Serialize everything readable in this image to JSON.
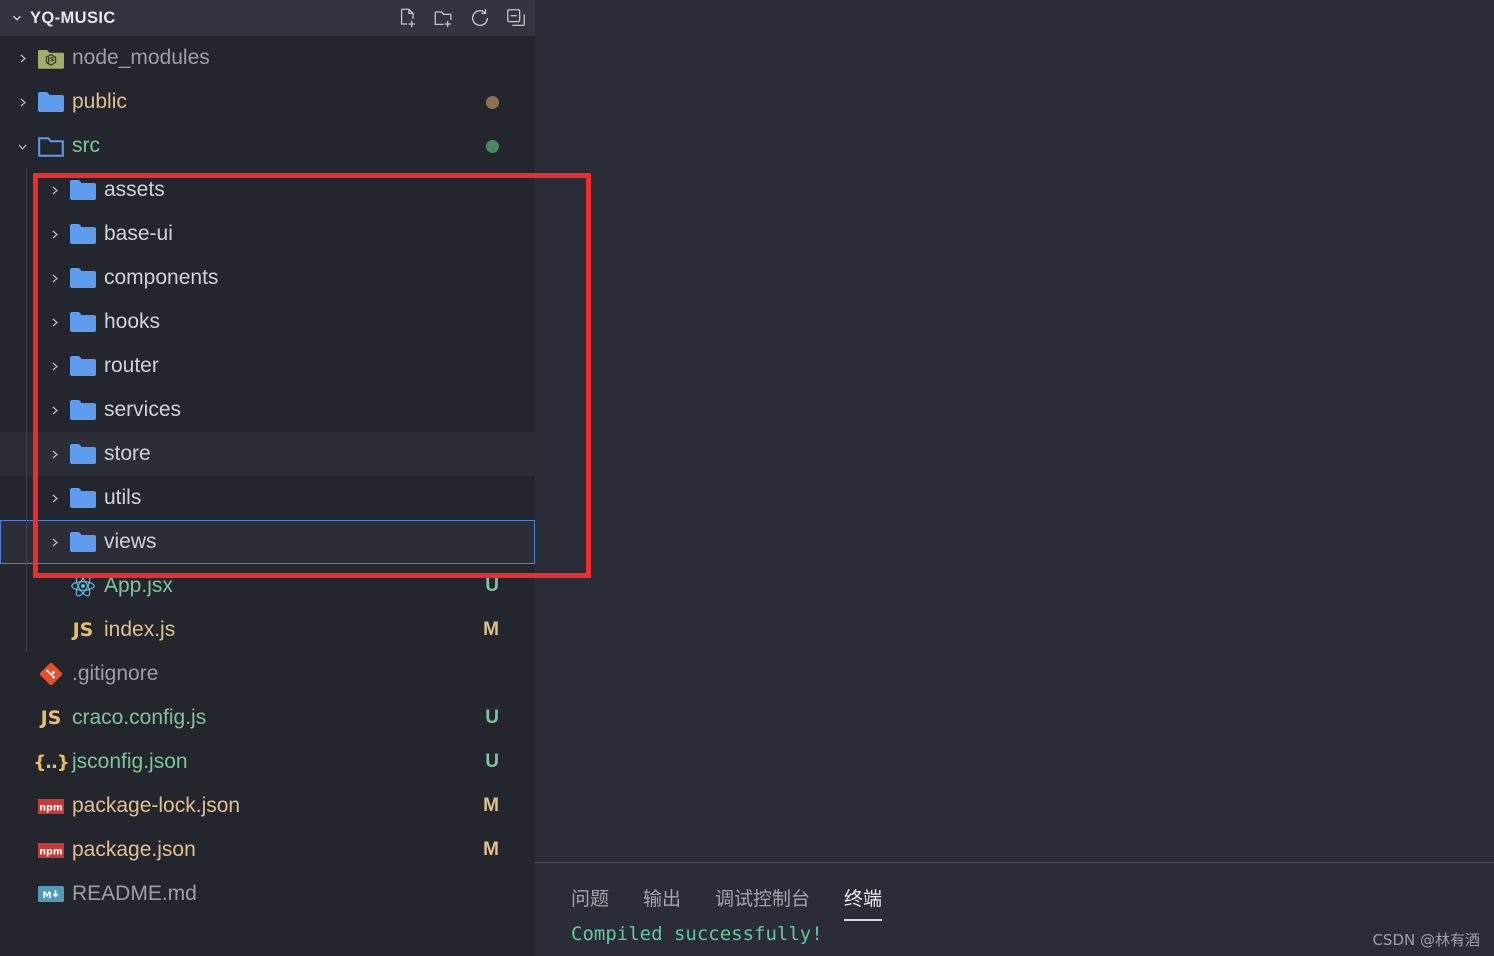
{
  "sidebar": {
    "title": "YQ-MUSIC",
    "twisty_icon": "chevron-down-icon",
    "actions": [
      {
        "name": "new-file-icon",
        "label": "New File"
      },
      {
        "name": "new-folder-icon",
        "label": "New Folder"
      },
      {
        "name": "refresh-icon",
        "label": "Refresh Explorer"
      },
      {
        "name": "collapse-all-icon",
        "label": "Collapse Folders in Explorer"
      }
    ],
    "tree": [
      {
        "label": "node_modules",
        "icon": "node-folder-icon",
        "chevron": "chevron-right-icon",
        "indent": 0,
        "color": "c-dim",
        "badge": "",
        "dot": ""
      },
      {
        "label": "public",
        "icon": "folder-icon",
        "chevron": "chevron-right-icon",
        "indent": 0,
        "color": "c-orange",
        "badge": "",
        "dot": "#8a7252"
      },
      {
        "label": "src",
        "icon": "folder-open-icon",
        "chevron": "chevron-down-icon",
        "indent": 0,
        "color": "c-green",
        "badge": "",
        "dot": "#4f8562"
      },
      {
        "label": "assets",
        "icon": "folder-icon",
        "chevron": "chevron-right-icon",
        "indent": 1,
        "color": "c-default",
        "badge": "",
        "dot": ""
      },
      {
        "label": "base-ui",
        "icon": "folder-icon",
        "chevron": "chevron-right-icon",
        "indent": 1,
        "color": "c-default",
        "badge": "",
        "dot": ""
      },
      {
        "label": "components",
        "icon": "folder-icon",
        "chevron": "chevron-right-icon",
        "indent": 1,
        "color": "c-default",
        "badge": "",
        "dot": ""
      },
      {
        "label": "hooks",
        "icon": "folder-icon",
        "chevron": "chevron-right-icon",
        "indent": 1,
        "color": "c-default",
        "badge": "",
        "dot": ""
      },
      {
        "label": "router",
        "icon": "folder-icon",
        "chevron": "chevron-right-icon",
        "indent": 1,
        "color": "c-default",
        "badge": "",
        "dot": ""
      },
      {
        "label": "services",
        "icon": "folder-icon",
        "chevron": "chevron-right-icon",
        "indent": 1,
        "color": "c-default",
        "badge": "",
        "dot": ""
      },
      {
        "label": "store",
        "icon": "folder-icon",
        "chevron": "chevron-right-icon",
        "indent": 1,
        "color": "c-default",
        "badge": "",
        "dot": "",
        "state": "hover"
      },
      {
        "label": "utils",
        "icon": "folder-icon",
        "chevron": "chevron-right-icon",
        "indent": 1,
        "color": "c-default",
        "badge": "",
        "dot": ""
      },
      {
        "label": "views",
        "icon": "folder-icon",
        "chevron": "chevron-right-icon",
        "indent": 1,
        "color": "c-default",
        "badge": "",
        "dot": "",
        "state": "focus"
      },
      {
        "label": "App.jsx",
        "icon": "react-icon",
        "chevron": "",
        "indent": 1,
        "color": "c-green",
        "badge": "U",
        "badge_color": "#7ec699",
        "dot": ""
      },
      {
        "label": "index.js",
        "icon": "js-icon",
        "chevron": "",
        "indent": 1,
        "color": "c-orange",
        "badge": "M",
        "badge_color": "#e2c08d",
        "dot": ""
      },
      {
        "label": ".gitignore",
        "icon": "git-icon",
        "chevron": "",
        "indent": 0,
        "color": "c-dim",
        "badge": "",
        "dot": ""
      },
      {
        "label": "craco.config.js",
        "icon": "js-icon",
        "chevron": "",
        "indent": 0,
        "color": "c-green",
        "badge": "U",
        "badge_color": "#7ec699",
        "dot": ""
      },
      {
        "label": "jsconfig.json",
        "icon": "json-icon",
        "chevron": "",
        "indent": 0,
        "color": "c-green",
        "badge": "U",
        "badge_color": "#7ec699",
        "dot": ""
      },
      {
        "label": "package-lock.json",
        "icon": "npm-icon",
        "chevron": "",
        "indent": 0,
        "color": "c-orange",
        "badge": "M",
        "badge_color": "#e2c08d",
        "dot": ""
      },
      {
        "label": "package.json",
        "icon": "npm-icon",
        "chevron": "",
        "indent": 0,
        "color": "c-orange",
        "badge": "M",
        "badge_color": "#e2c08d",
        "dot": ""
      },
      {
        "label": "README.md",
        "icon": "markdown-icon",
        "chevron": "",
        "indent": 0,
        "color": "c-dim",
        "badge": "",
        "dot": ""
      }
    ]
  },
  "annotation": {
    "red_box_color": "#f22a2a",
    "selection_outline_color": "#4f7fd6"
  },
  "panel": {
    "tabs": [
      {
        "label": "问题",
        "active": false
      },
      {
        "label": "输出",
        "active": false
      },
      {
        "label": "调试控制台",
        "active": false
      },
      {
        "label": "终端",
        "active": true
      }
    ],
    "terminal_line": "Compiled successfully!"
  },
  "watermark": "CSDN @林有酒",
  "colors": {
    "sidebar_bg": "#24262e",
    "editor_bg": "#2a2d37",
    "header_bg": "#32353f",
    "folder_blue": "#5e9cf0"
  }
}
